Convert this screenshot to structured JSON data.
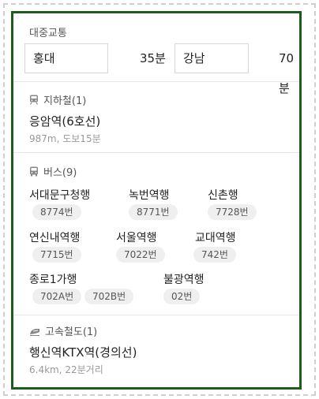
{
  "header": {
    "title": "대중교통"
  },
  "route": [
    {
      "place": "홍대",
      "time": "35분"
    },
    {
      "place": "강남",
      "time": "70분"
    }
  ],
  "subway": {
    "title": "지하철(1)",
    "station": "응암역(6호선)",
    "detail": "987m, 도보15분"
  },
  "bus": {
    "title": "버스(9)",
    "groups": [
      {
        "dest": "서대문구청행",
        "buses": [
          "8774번"
        ]
      },
      {
        "dest": "녹번역행",
        "buses": [
          "8771번"
        ]
      },
      {
        "dest": "신촌행",
        "buses": [
          "7728번"
        ]
      },
      {
        "dest": "연신내역행",
        "buses": [
          "7715번"
        ]
      },
      {
        "dest": "서울역행",
        "buses": [
          "7022번"
        ]
      },
      {
        "dest": "교대역행",
        "buses": [
          "742번"
        ]
      },
      {
        "dest": "종로1가행",
        "buses": [
          "702A번",
          "702B번"
        ]
      },
      {
        "dest": "불광역행",
        "buses": [
          "02번"
        ]
      }
    ]
  },
  "rail": {
    "title": "고속철도(1)",
    "station": "행신역KTX역(경의선)",
    "detail": "6.4km, 22분거리"
  },
  "colors": {
    "border": "#1f5a1f",
    "chip_bg": "#efefef",
    "muted": "#999999"
  }
}
